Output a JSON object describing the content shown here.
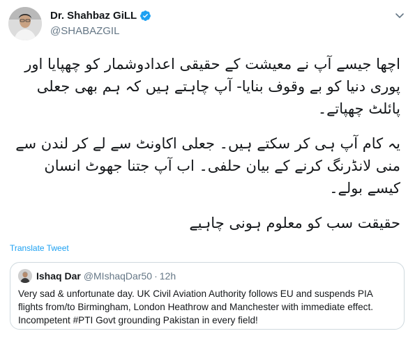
{
  "author": {
    "name": "Dr. Shahbaz GiLL",
    "handle": "@SHABAZGIL",
    "verified": true
  },
  "tweet": {
    "paragraphs": [
      "اچھا جیسے آپ نے معیشت کے حقیقی اعدادوشمار کو چھپایا اور پوری دنیا کو بے وقوف بنایا- آپ چاہتے ہیں کہ ہم بھی جعلی پائلٹ چھپاتے۔",
      "یہ کام آپ ہی کر سکتے ہیں۔ جعلی اکاونٹ سے لے کر لندن سے منی لانڈرنگ کرنے کے بیان حلفی۔ اب آپ جتنا جھوٹ انسان کیسے بولے۔",
      "حقیقت سب کو معلوم ہونی چاہیے"
    ],
    "translate_label": "Translate Tweet"
  },
  "quoted": {
    "name": "Ishaq Dar",
    "handle": "@MIshaqDar50",
    "separator": "·",
    "time": "12h",
    "text": "Very sad & unfortunate day. UK Civil Aviation Authority follows EU and suspends PIA flights from/to Birmingham, London Heathrow and Manchester with immediate effect. Incompetent #PTI Govt grounding Pakistan in every field!"
  },
  "icons": {
    "verified": "verified-badge-icon",
    "menu": "chevron-down-icon"
  },
  "colors": {
    "accent": "#1da1f2",
    "text": "#14171a",
    "muted": "#657786",
    "border": "#cfd9de"
  }
}
